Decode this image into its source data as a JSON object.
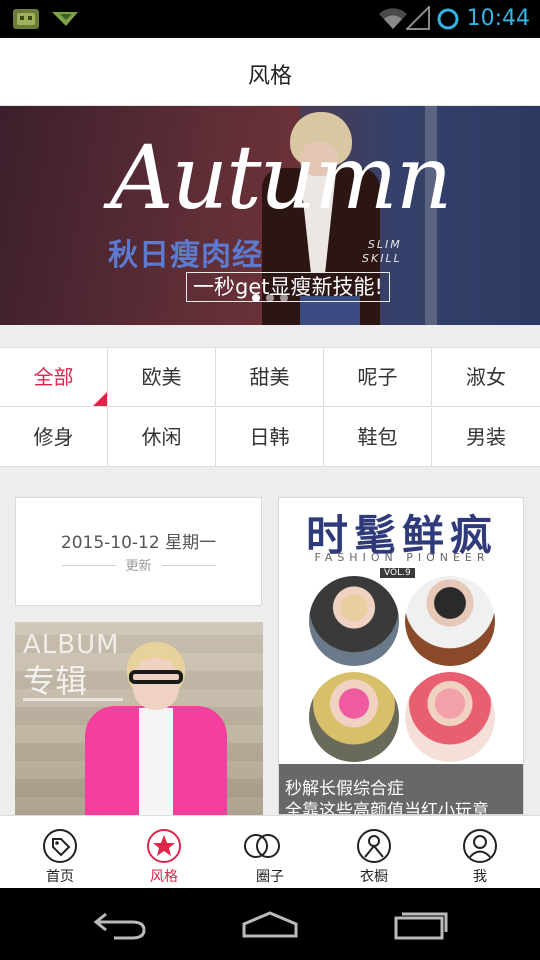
{
  "status_bar": {
    "time": "10:44",
    "icons": [
      "android-notification-icon",
      "airplane-notification-icon",
      "wifi-icon",
      "signal-icon",
      "sync-icon"
    ]
  },
  "header": {
    "title": "风格"
  },
  "banner": {
    "script_text": "Autumn",
    "headline": "秋日瘦肉经",
    "tag_line1": "SLIM",
    "tag_line2": "SKILL",
    "tagline": "一秒get显瘦新技能!",
    "slides": 3,
    "active_slide": 1
  },
  "categories": {
    "row1": [
      "全部",
      "欧美",
      "甜美",
      "呢子",
      "淑女"
    ],
    "row2": [
      "修身",
      "休闲",
      "日韩",
      "鞋包",
      "男装"
    ],
    "active": "全部"
  },
  "feed": {
    "date_card": {
      "date": "2015-10-12 星期一",
      "update_label": "更新"
    },
    "album_card": {
      "title_en": "ALBUM",
      "title_cn": "专辑"
    },
    "fashion_card": {
      "title": "时髦鲜疯",
      "subtitle": "FASHION PIONEER",
      "volume": "VOL.9",
      "caption_line1": "秒解长假综合症",
      "caption_line2": "全靠这些高颜值当红小玩意"
    }
  },
  "tab_bar": {
    "tabs": [
      {
        "label": "首页",
        "icon": "home-tag-icon"
      },
      {
        "label": "风格",
        "icon": "star-icon"
      },
      {
        "label": "圈子",
        "icon": "circles-icon"
      },
      {
        "label": "衣橱",
        "icon": "wardrobe-icon"
      },
      {
        "label": "我",
        "icon": "profile-icon"
      }
    ],
    "active": "风格"
  },
  "nav_bar": {
    "buttons": [
      "back",
      "home",
      "recents"
    ]
  },
  "colors": {
    "accent": "#e0254a",
    "status_time": "#33b5e5",
    "fashion_title": "#2f3a7a"
  }
}
